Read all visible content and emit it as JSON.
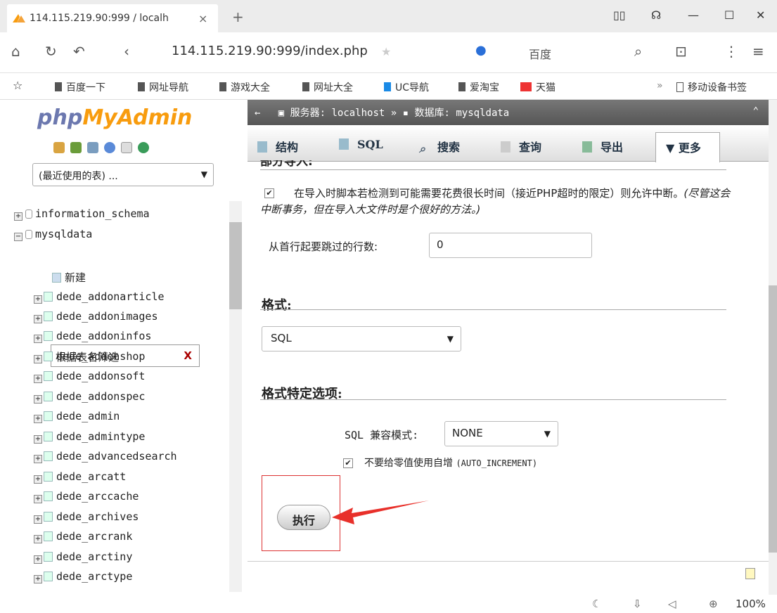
{
  "browser": {
    "tab_title": "114.115.219.90:999 / localh",
    "tab_close": "×",
    "new_tab": "+",
    "url": "114.115.219.90:999/index.php",
    "search_engine": "百度",
    "bookmarks": [
      "百度一下",
      "网址导航",
      "游戏大全",
      "网址大全",
      "UC导航",
      "爱淘宝",
      "天猫"
    ],
    "bookmarks_overflow": "»",
    "mobile_bookmarks": "移动设备书签",
    "zoom": "100%"
  },
  "sidebar": {
    "logo_php": "php",
    "logo_myadmin": "MyAdmin",
    "recent_select": "(最近使用的表) ...",
    "filter_placeholder": "根据表名筛选",
    "filter_clear": "X",
    "new_label": "新建",
    "databases": [
      "information_schema",
      "mysqldata"
    ],
    "tables": [
      "dede_addonarticle",
      "dede_addonimages",
      "dede_addoninfos",
      "dede_addonshop",
      "dede_addonsoft",
      "dede_addonspec",
      "dede_admin",
      "dede_admintype",
      "dede_advancedsearch",
      "dede_arcatt",
      "dede_arccache",
      "dede_archives",
      "dede_arcrank",
      "dede_arctiny",
      "dede_arctype"
    ]
  },
  "main": {
    "breadcrumb_server": "服务器: localhost",
    "breadcrumb_sep": "»",
    "breadcrumb_db": "数据库: mysqldata",
    "tabs": [
      "结构",
      "SQL",
      "搜索",
      "查询",
      "导出",
      "更多"
    ],
    "partial_import_heading": "部分导入:",
    "interrupt_label": "在导入时脚本若检测到可能需要花费很长时间（接近PHP超时的限定）则允许中断。",
    "interrupt_hint": "(尽管这会中断事务，但在导入大文件时是个很好的方法。)",
    "skip_rows_label": "从首行起要跳过的行数:",
    "skip_rows_value": "0",
    "format_heading": "格式:",
    "format_value": "SQL",
    "format_options_heading": "格式特定选项:",
    "compat_label": "SQL 兼容模式:",
    "compat_value": "NONE",
    "no_auto_value_label": "不要给零值使用自增",
    "no_auto_value_code": "(AUTO_INCREMENT)",
    "go_button": "执行"
  }
}
